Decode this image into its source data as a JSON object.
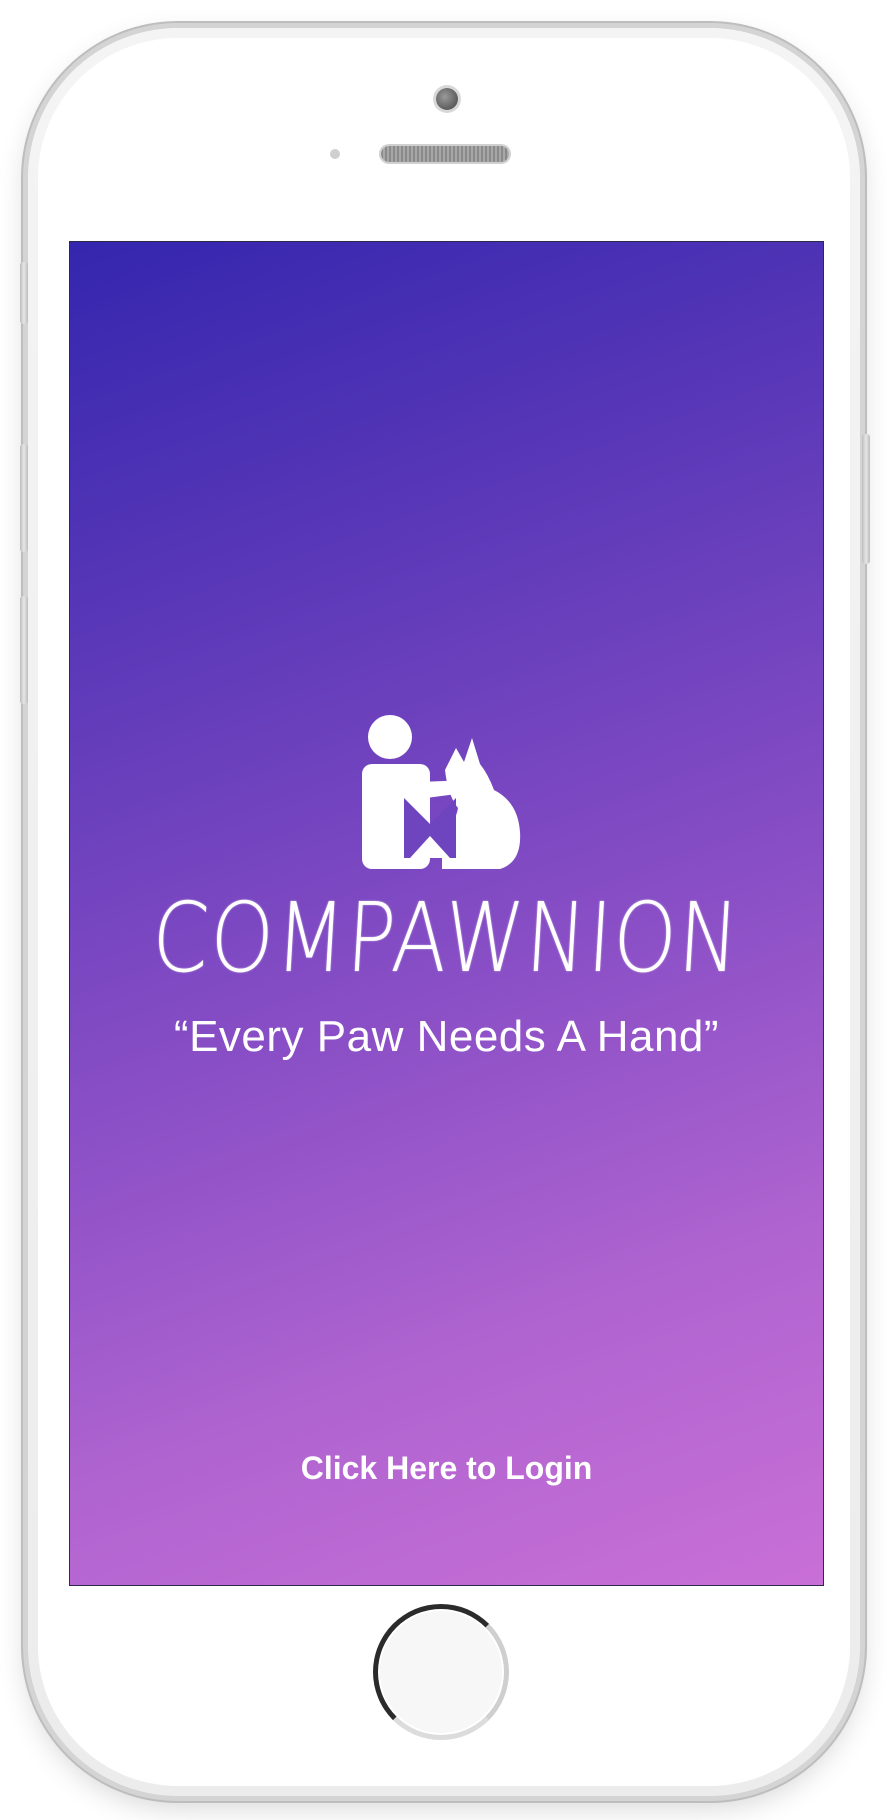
{
  "app": {
    "brand_name": "COMPAWNION",
    "tagline": "“Every Paw Needs A Hand”",
    "login_label": "Click Here to Login"
  },
  "icons": {
    "logo": "person-petting-dog-icon"
  },
  "colors": {
    "gradient_start": "#3426ae",
    "gradient_end": "#c96fd7",
    "text": "#ffffff"
  }
}
